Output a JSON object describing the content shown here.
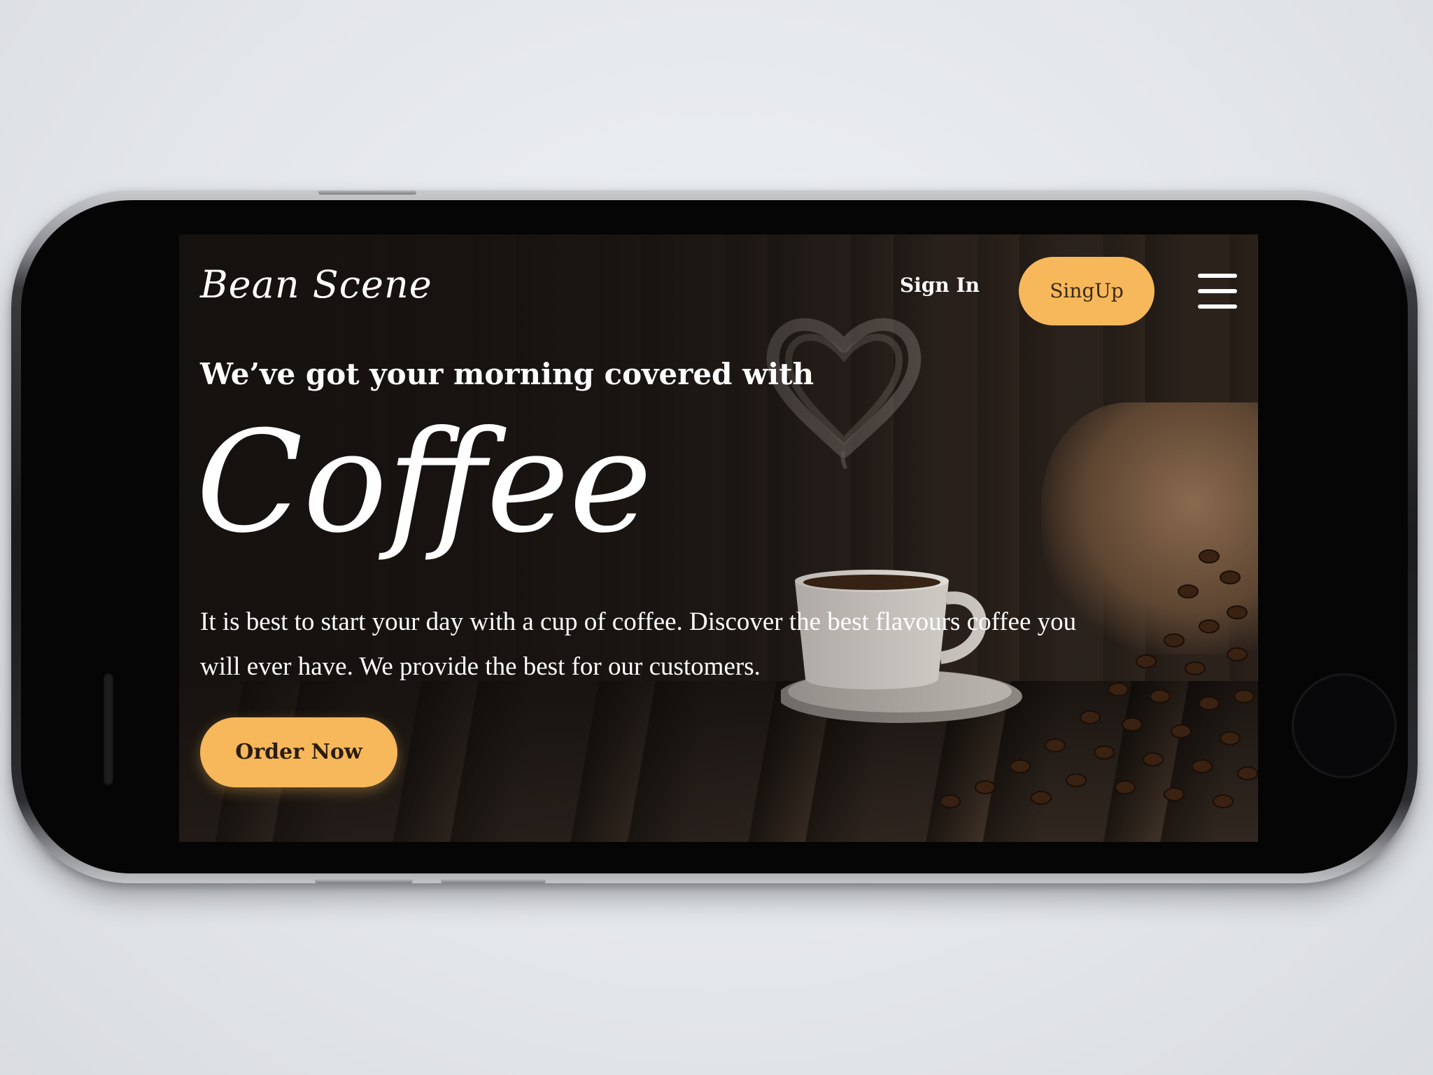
{
  "nav": {
    "logo": "Bean Scene",
    "sign_in": "Sign In",
    "sign_up": "SingUp",
    "menu_icon": "hamburger-menu-icon"
  },
  "hero": {
    "tagline": "We’ve got your morning covered with",
    "headline": "Coffee",
    "description": "It is best to start your day with a cup of coffee. Discover the best flavours coffee you will ever have. We provide the best for our customers.",
    "cta": "Order Now"
  },
  "colors": {
    "accent": "#f6b85a",
    "background": "#1a1512",
    "text": "#ffffff"
  }
}
